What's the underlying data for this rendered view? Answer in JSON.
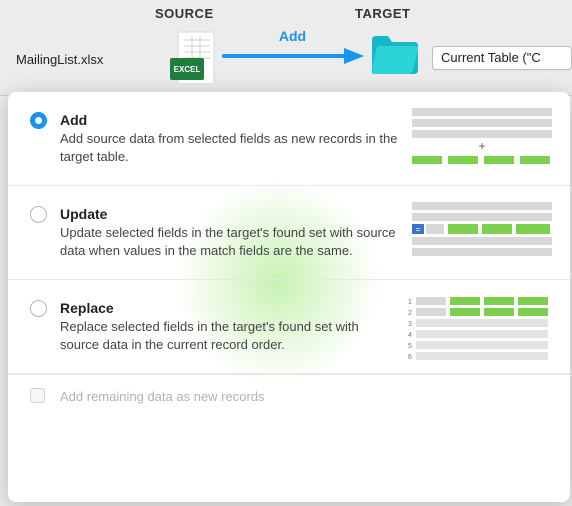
{
  "topbar": {
    "source_label": "SOURCE",
    "target_label": "TARGET",
    "file_name": "MailingList.xlsx",
    "arrow_label": "Add",
    "excel_badge": "EXCEL",
    "target_dropdown": "Current Table (\"C"
  },
  "options": {
    "add": {
      "title": "Add",
      "desc": "Add source data from selected fields as new records in the target table."
    },
    "update": {
      "title": "Update",
      "desc": "Update selected fields in the target's found set with source data when values in the match fields are the same."
    },
    "replace": {
      "title": "Replace",
      "desc": "Replace selected fields in the target's found set with source data in the current record order.",
      "row_labels": [
        "1",
        "2",
        "3",
        "4",
        "5",
        "6"
      ]
    }
  },
  "checkbox": {
    "label": "Add remaining data as new records"
  },
  "colors": {
    "accent": "#1a93ec",
    "green": "#7dcf4d"
  }
}
